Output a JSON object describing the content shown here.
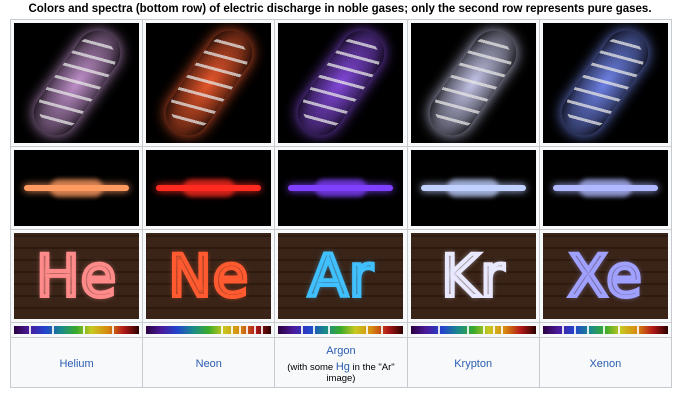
{
  "caption": "Colors and spectra (bottom row) of electric discharge in noble gases; only the second row represents pure gases.",
  "gases": [
    {
      "name": "Helium",
      "color": "#e8a0e8",
      "tube_color": "#d4a0e0",
      "bar_color": "#ff9a60",
      "letters": "He",
      "letters_color": "#ff8a8a"
    },
    {
      "name": "Neon",
      "color": "#ff4a20",
      "tube_color": "#ff6030",
      "bar_color": "#ff2a20",
      "letters": "Ne",
      "letters_color": "#ff5a30"
    },
    {
      "name": "Argon",
      "color": "#a060ff",
      "tube_color": "#9050f0",
      "bar_color": "#8040ff",
      "letters": "Ar",
      "letters_color": "#40c0ff"
    },
    {
      "name": "Krypton",
      "color": "#c0c0ff",
      "tube_color": "#d8d8ff",
      "bar_color": "#c0d0ff",
      "letters": "Kr",
      "letters_color": "#e8e8ff"
    },
    {
      "name": "Xenon",
      "color": "#8aa0ff",
      "tube_color": "#7a90ff",
      "bar_color": "#b0b8ff",
      "letters": "Xe",
      "letters_color": "#a0a0ff"
    }
  ],
  "argon_note_prefix": "(with some ",
  "argon_note_link": "Hg",
  "argon_note_suffix": " in the \"Ar\" image)"
}
